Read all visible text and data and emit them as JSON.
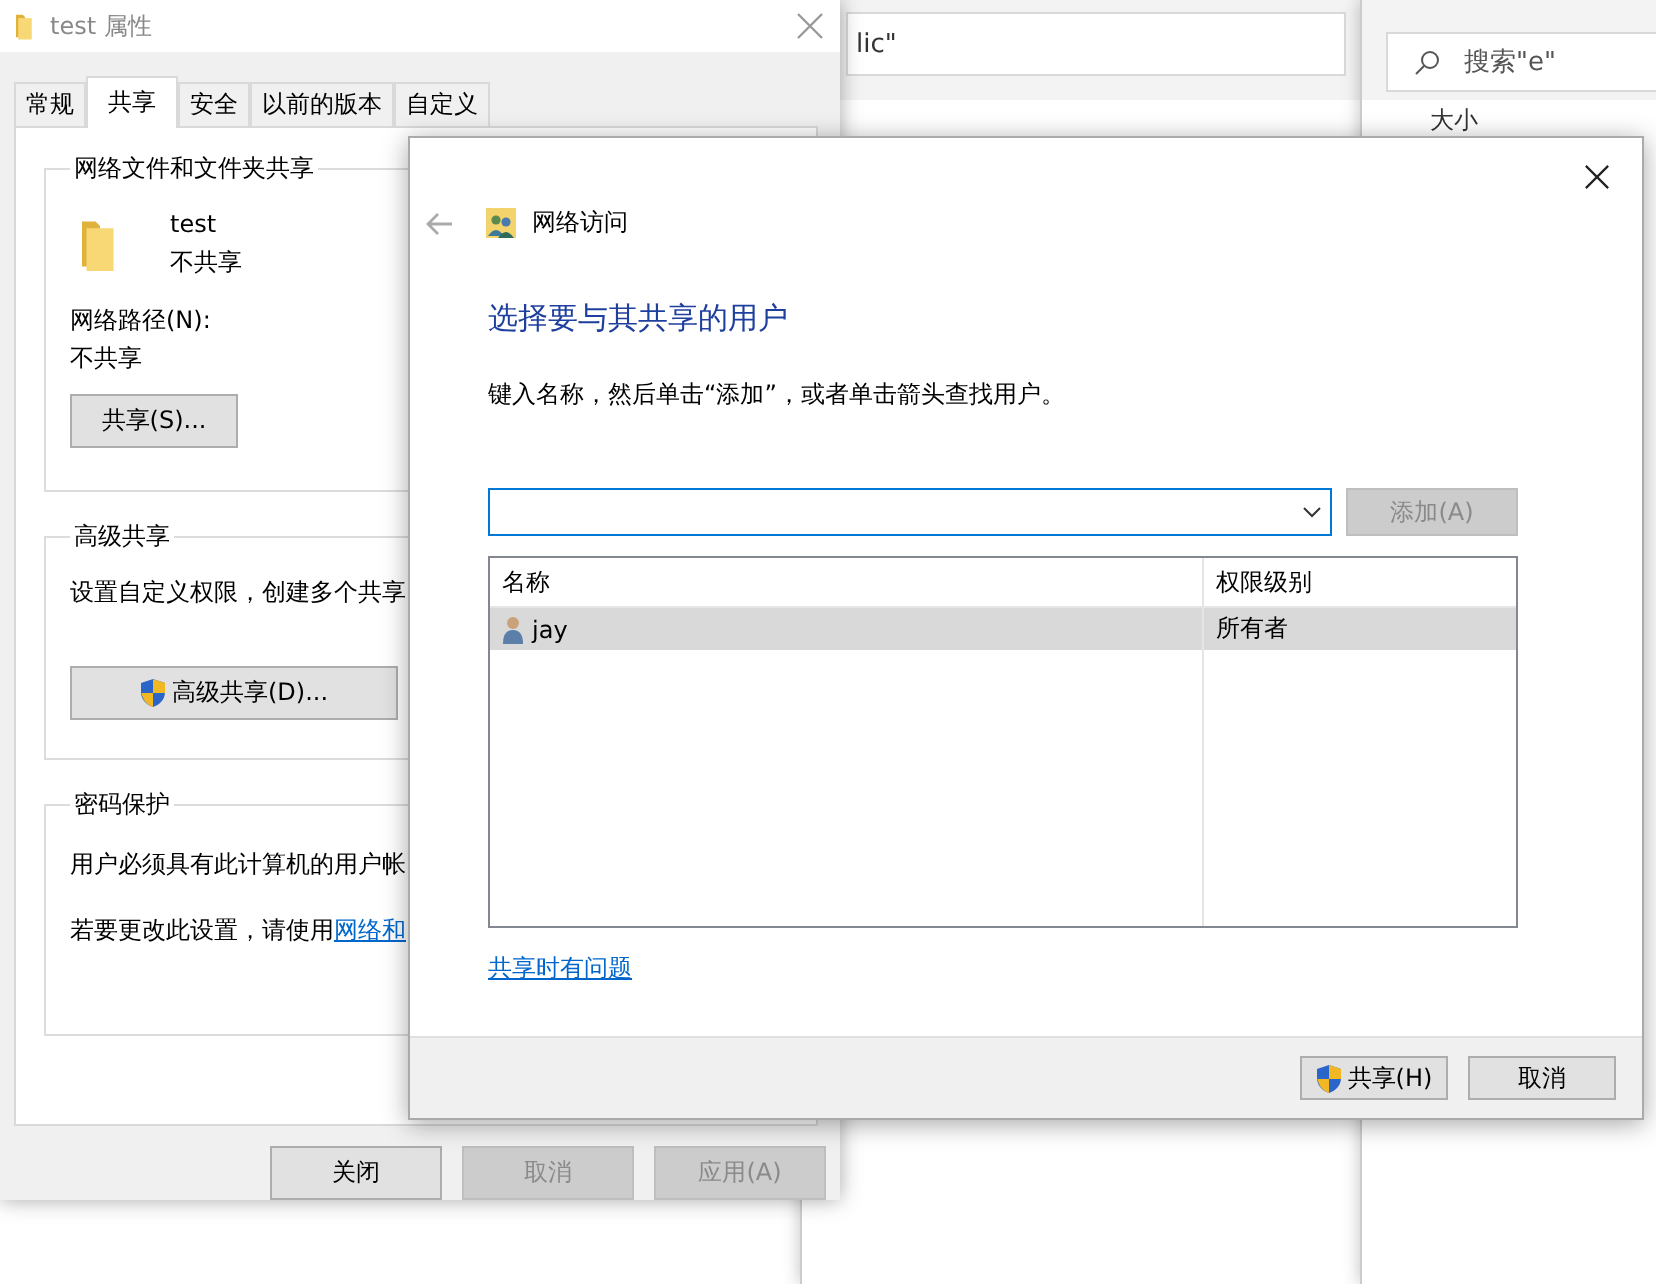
{
  "background_windows": [
    {
      "kind": "address",
      "text": "lic\""
    },
    {
      "kind": "search",
      "placeholder": "搜索\"e\"",
      "column": "大小"
    }
  ],
  "properties": {
    "title": "test 属性",
    "tabs": [
      {
        "label": "常规",
        "selected": false
      },
      {
        "label": "共享",
        "selected": true
      },
      {
        "label": "安全",
        "selected": false
      },
      {
        "label": "以前的版本",
        "selected": false
      },
      {
        "label": "自定义",
        "selected": false
      }
    ],
    "sharing_group": {
      "title": "网络文件和文件夹共享",
      "item_name": "test",
      "item_status": "不共享",
      "path_label": "网络路径(N):",
      "path_value": "不共享",
      "button": "共享(S)..."
    },
    "advanced_group": {
      "title": "高级共享",
      "description": "设置自定义权限，创建多个共享",
      "button": "高级共享(D)..."
    },
    "password_group": {
      "title": "密码保护",
      "description": "用户必须具有此计算机的用户帐",
      "note": "若要更改此设置，请使用",
      "link": "网络和"
    },
    "buttons": [
      {
        "label": "关闭",
        "disabled": false
      },
      {
        "label": "取消",
        "disabled": true
      },
      {
        "label": "应用(A)",
        "disabled": true
      }
    ]
  },
  "dialog": {
    "title": "网络访问",
    "heading": "选择要与其共享的用户",
    "instruction": "键入名称，然后单击“添加”，或者单击箭头查找用户。",
    "add_button": {
      "label": "添加(A)",
      "disabled": true
    },
    "columns": [
      "名称",
      "权限级别"
    ],
    "rows": [
      {
        "name": "jay",
        "permission": "所有者",
        "selected": true
      }
    ],
    "help_link": "共享时有问题",
    "buttons": [
      {
        "label": "共享(H)",
        "shield": true
      },
      {
        "label": "取消",
        "shield": false
      }
    ]
  }
}
